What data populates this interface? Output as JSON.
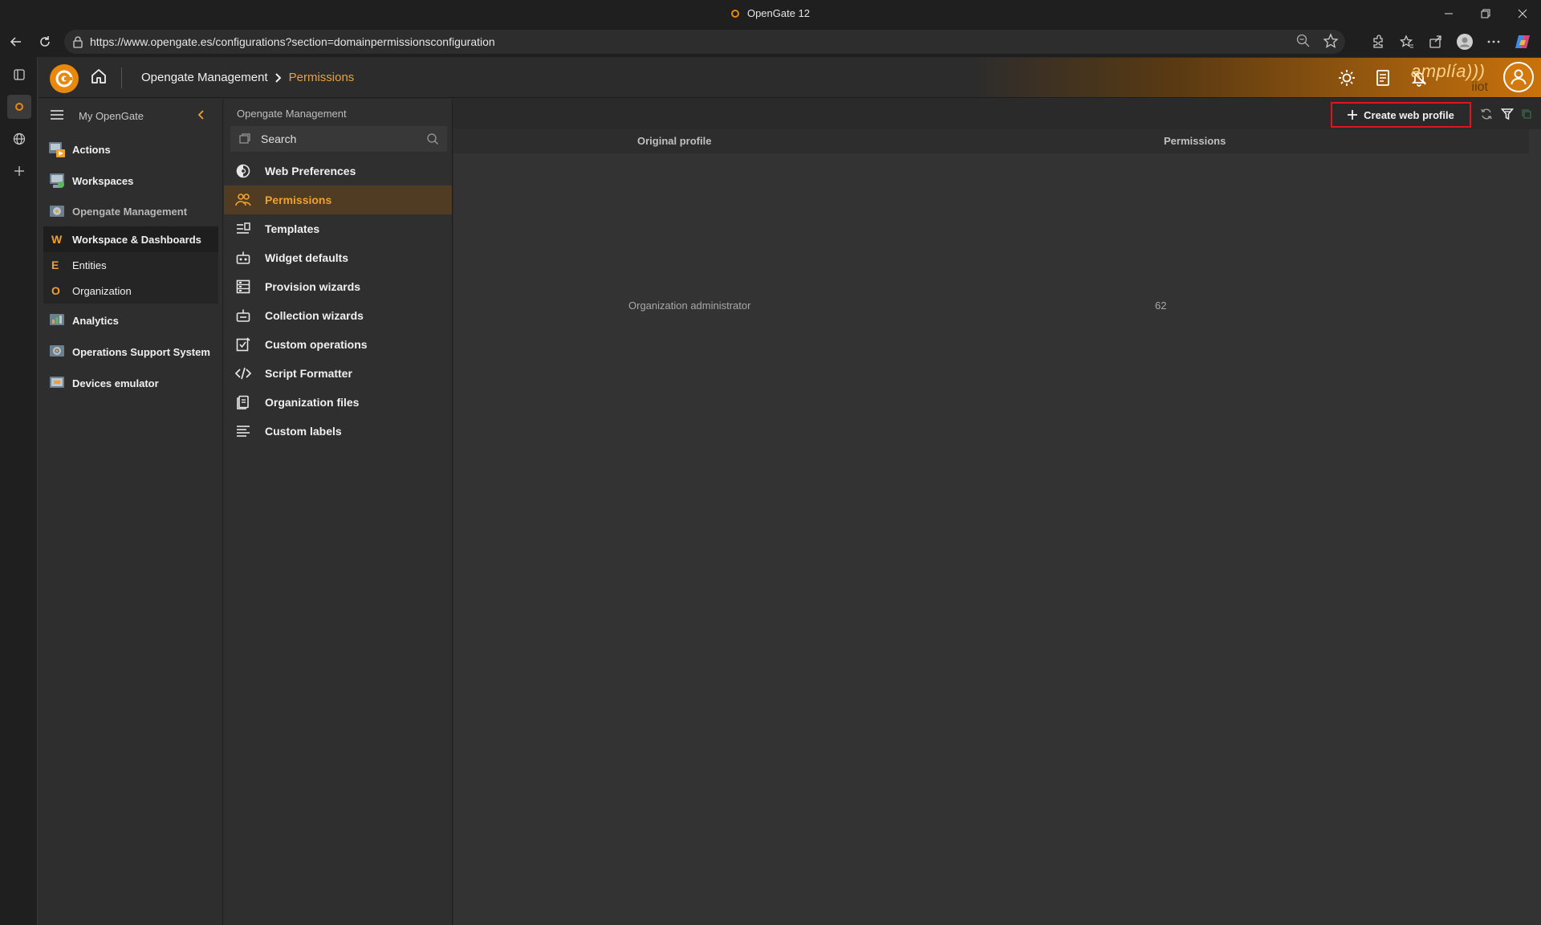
{
  "window": {
    "title": "OpenGate 12"
  },
  "browser": {
    "url": "https://www.opengate.es/configurations?section=domainpermissionsconfiguration"
  },
  "header": {
    "breadcrumb": [
      "Opengate Management",
      "Permissions"
    ],
    "brand_main": "amplía)))",
    "brand_sub": "iiot"
  },
  "left_menu": {
    "title": "My OpenGate",
    "items": [
      {
        "label": "Actions"
      },
      {
        "label": "Workspaces"
      },
      {
        "label": "Opengate Management"
      },
      {
        "label": "Analytics"
      },
      {
        "label": "Operations Support System"
      },
      {
        "label": "Devices emulator"
      }
    ],
    "sub_items": [
      {
        "letter": "W",
        "label": "Workspace & Dashboards"
      },
      {
        "letter": "E",
        "label": "Entities"
      },
      {
        "letter": "O",
        "label": "Organization"
      }
    ]
  },
  "second_menu": {
    "title": "Opengate Management",
    "search_placeholder": "Search",
    "items": [
      {
        "label": "Web Preferences",
        "icon": "palette-icon"
      },
      {
        "label": "Permissions",
        "icon": "users-group-icon",
        "selected": true
      },
      {
        "label": "Templates",
        "icon": "template-list-icon"
      },
      {
        "label": "Widget defaults",
        "icon": "widget-icon"
      },
      {
        "label": "Provision wizards",
        "icon": "wizard-icon"
      },
      {
        "label": "Collection wizards",
        "icon": "collection-icon"
      },
      {
        "label": "Custom operations",
        "icon": "custom-operation-icon"
      },
      {
        "label": "Script Formatter",
        "icon": "code-icon"
      },
      {
        "label": "Organization files",
        "icon": "files-icon"
      },
      {
        "label": "Custom labels",
        "icon": "lines-icon"
      }
    ]
  },
  "main": {
    "create_button_label": "Create web profile",
    "columns": [
      "Original profile",
      "Permissions"
    ],
    "rows": [
      {
        "original_profile": "Organization administrator",
        "permissions": "62"
      }
    ]
  },
  "colors": {
    "accent": "#f0a030",
    "highlight_border": "#e0141e",
    "selected_bg": "#4f3c22"
  }
}
